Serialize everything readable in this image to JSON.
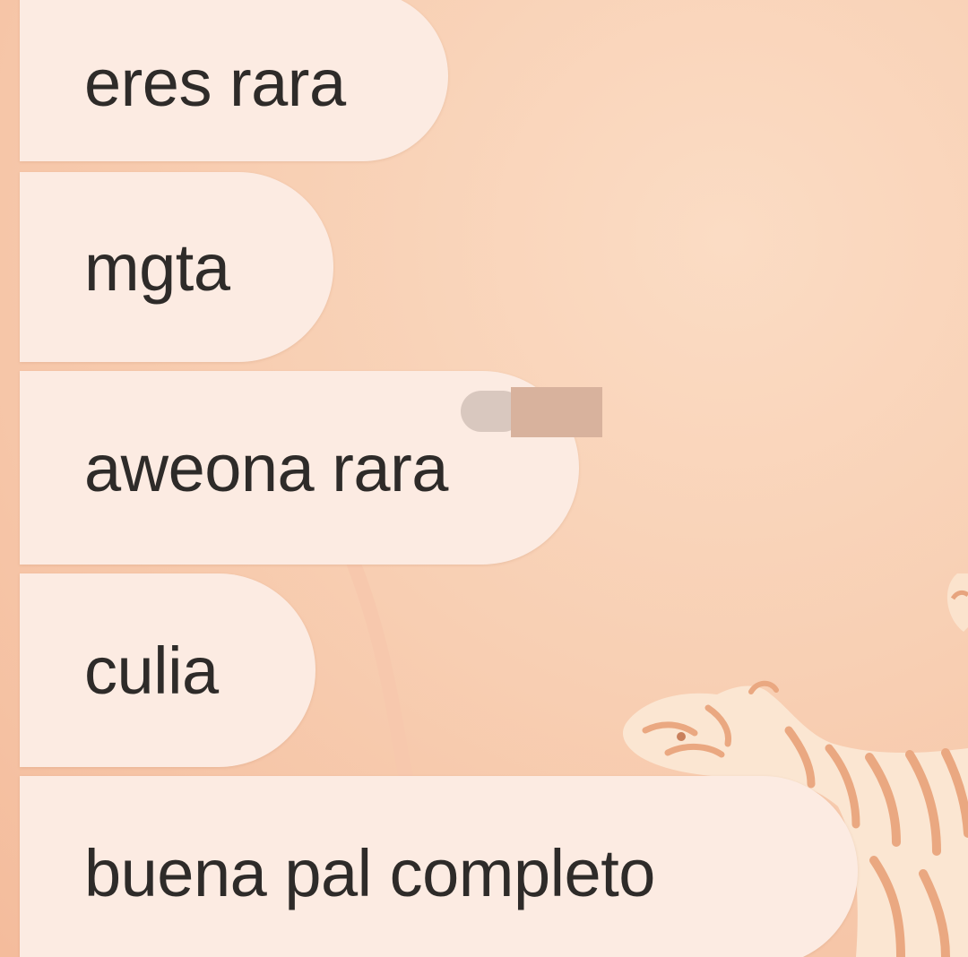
{
  "chat": {
    "wallpaper": {
      "background_color": "#f8cfb3",
      "illustration": "tiger-illustration"
    },
    "bubble_color": "#fcebe2",
    "text_color": "#2e2b29",
    "messages": [
      {
        "text": "eres rara"
      },
      {
        "text": "mgta"
      },
      {
        "text": "aweona rara"
      },
      {
        "text": "culia"
      },
      {
        "text": "buena pal completo"
      }
    ]
  }
}
